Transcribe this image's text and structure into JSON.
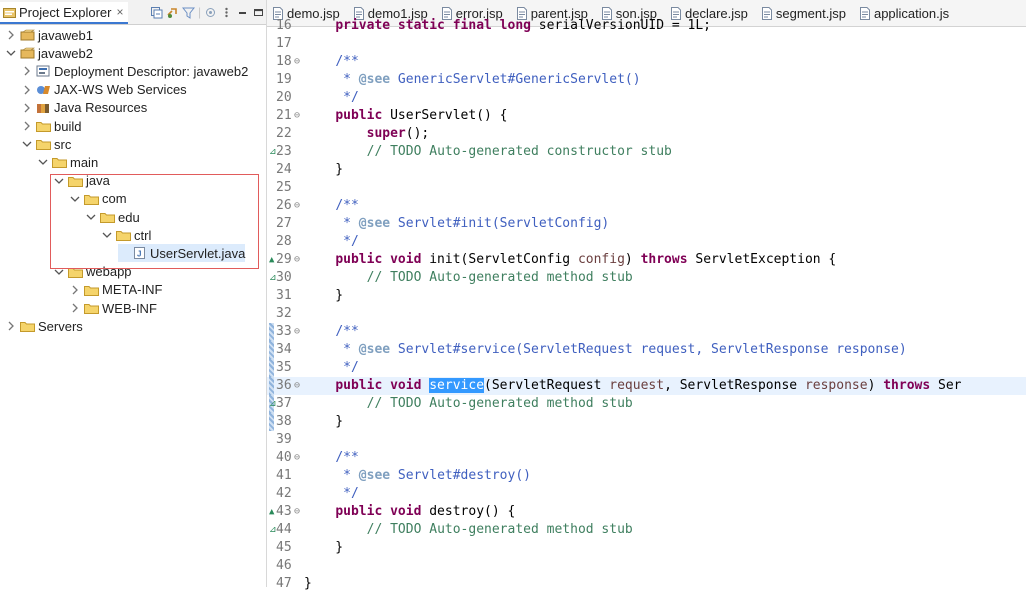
{
  "explorer": {
    "tab_label": "Project Explorer",
    "tab_close": "×",
    "tree": [
      {
        "label": "javaweb1",
        "icon": "project-icon",
        "expanded": false,
        "indent": 0
      },
      {
        "label": "javaweb2",
        "icon": "project-icon",
        "expanded": true,
        "indent": 0
      },
      {
        "label": "Deployment Descriptor: javaweb2",
        "icon": "descriptor-icon",
        "expanded": false,
        "indent": 1
      },
      {
        "label": "JAX-WS Web Services",
        "icon": "webservice-icon",
        "expanded": false,
        "indent": 1
      },
      {
        "label": "Java Resources",
        "icon": "library-icon",
        "expanded": false,
        "indent": 1
      },
      {
        "label": "build",
        "icon": "folder-icon",
        "expanded": false,
        "indent": 1
      },
      {
        "label": "src",
        "icon": "folder-icon",
        "expanded": true,
        "indent": 1
      },
      {
        "label": "main",
        "icon": "folder-icon",
        "expanded": true,
        "indent": 2
      },
      {
        "label": "java",
        "icon": "folder-icon",
        "expanded": true,
        "indent": 3
      },
      {
        "label": "com",
        "icon": "folder-icon",
        "expanded": true,
        "indent": 4
      },
      {
        "label": "edu",
        "icon": "folder-icon",
        "expanded": true,
        "indent": 5
      },
      {
        "label": "ctrl",
        "icon": "folder-icon",
        "expanded": true,
        "indent": 6
      },
      {
        "label": "UserServlet.java",
        "icon": "java-file-icon",
        "expanded": null,
        "indent": 7
      },
      {
        "label": "webapp",
        "icon": "folder-icon",
        "expanded": true,
        "indent": 3
      },
      {
        "label": "META-INF",
        "icon": "folder-icon",
        "expanded": false,
        "indent": 4
      },
      {
        "label": "WEB-INF",
        "icon": "folder-icon",
        "expanded": false,
        "indent": 4
      },
      {
        "label": "Servers",
        "icon": "folder-icon",
        "expanded": false,
        "indent": 0
      }
    ]
  },
  "editor": {
    "tabs": [
      "demo.jsp",
      "demo1.jsp",
      "error.jsp",
      "parent.jsp",
      "son.jsp",
      "declare.jsp",
      "segment.jsp",
      "application.js"
    ],
    "lines": [
      {
        "n": "16",
        "tokens": [
          {
            "t": "    "
          },
          {
            "t": "private static final long",
            "c": "kw"
          },
          {
            "t": " serialVersionUID = 1L;"
          }
        ]
      },
      {
        "n": "17",
        "tokens": []
      },
      {
        "n": "18",
        "fold": "⊖",
        "tokens": [
          {
            "t": "    "
          },
          {
            "t": "/**",
            "c": "jd"
          }
        ]
      },
      {
        "n": "19",
        "tokens": [
          {
            "t": "     * ",
            "c": "jd"
          },
          {
            "t": "@see",
            "c": "tag"
          },
          {
            "t": " GenericServlet#GenericServlet()",
            "c": "jd"
          }
        ]
      },
      {
        "n": "20",
        "tokens": [
          {
            "t": "     */",
            "c": "jd"
          }
        ]
      },
      {
        "n": "21",
        "fold": "⊖",
        "tokens": [
          {
            "t": "    "
          },
          {
            "t": "public",
            "c": "kw"
          },
          {
            "t": " UserServlet() {"
          }
        ]
      },
      {
        "n": "22",
        "tokens": [
          {
            "t": "        "
          },
          {
            "t": "super",
            "c": "kw"
          },
          {
            "t": "();"
          }
        ]
      },
      {
        "n": "23",
        "marker": "⊿",
        "tokens": [
          {
            "t": "        "
          },
          {
            "t": "// TODO Auto-generated constructor stub",
            "c": "cm"
          }
        ]
      },
      {
        "n": "24",
        "tokens": [
          {
            "t": "    }"
          }
        ]
      },
      {
        "n": "25",
        "tokens": []
      },
      {
        "n": "26",
        "fold": "⊖",
        "tokens": [
          {
            "t": "    "
          },
          {
            "t": "/**",
            "c": "jd"
          }
        ]
      },
      {
        "n": "27",
        "tokens": [
          {
            "t": "     * ",
            "c": "jd"
          },
          {
            "t": "@see",
            "c": "tag"
          },
          {
            "t": " Servlet#init(ServletConfig)",
            "c": "jd"
          }
        ]
      },
      {
        "n": "28",
        "tokens": [
          {
            "t": "     */",
            "c": "jd"
          }
        ]
      },
      {
        "n": "29",
        "fold": "⊖",
        "marker": "▲",
        "tokens": [
          {
            "t": "    "
          },
          {
            "t": "public void",
            "c": "kw"
          },
          {
            "t": " init(ServletConfig "
          },
          {
            "t": "config",
            "c": "var"
          },
          {
            "t": ") "
          },
          {
            "t": "throws",
            "c": "kw"
          },
          {
            "t": " ServletException {"
          }
        ]
      },
      {
        "n": "30",
        "marker": "⊿",
        "tokens": [
          {
            "t": "        "
          },
          {
            "t": "// TODO Auto-generated method stub",
            "c": "cm"
          }
        ]
      },
      {
        "n": "31",
        "tokens": [
          {
            "t": "    }"
          }
        ]
      },
      {
        "n": "32",
        "tokens": []
      },
      {
        "n": "33",
        "fold": "⊖",
        "strip": true,
        "tokens": [
          {
            "t": "    "
          },
          {
            "t": "/**",
            "c": "jd"
          }
        ]
      },
      {
        "n": "34",
        "strip": true,
        "tokens": [
          {
            "t": "     * ",
            "c": "jd"
          },
          {
            "t": "@see",
            "c": "tag"
          },
          {
            "t": " Servlet#service(ServletRequest request, ServletResponse response)",
            "c": "jd"
          }
        ]
      },
      {
        "n": "35",
        "strip": true,
        "tokens": [
          {
            "t": "     */",
            "c": "jd"
          }
        ]
      },
      {
        "n": "36",
        "fold": "⊖",
        "strip": true,
        "current": true,
        "tokens": [
          {
            "t": "    "
          },
          {
            "t": "public void",
            "c": "kw"
          },
          {
            "t": " "
          },
          {
            "t": "service",
            "c": "sel"
          },
          {
            "t": "(ServletRequest "
          },
          {
            "t": "request",
            "c": "var"
          },
          {
            "t": ", ServletResponse "
          },
          {
            "t": "response",
            "c": "var"
          },
          {
            "t": ") "
          },
          {
            "t": "throws",
            "c": "kw"
          },
          {
            "t": " Ser"
          }
        ]
      },
      {
        "n": "37",
        "strip": true,
        "marker": "⊿",
        "tokens": [
          {
            "t": "        "
          },
          {
            "t": "// TODO Auto-generated method stub",
            "c": "cm"
          }
        ]
      },
      {
        "n": "38",
        "strip": true,
        "tokens": [
          {
            "t": "    }"
          }
        ]
      },
      {
        "n": "39",
        "tokens": []
      },
      {
        "n": "40",
        "fold": "⊖",
        "tokens": [
          {
            "t": "    "
          },
          {
            "t": "/**",
            "c": "jd"
          }
        ]
      },
      {
        "n": "41",
        "tokens": [
          {
            "t": "     * ",
            "c": "jd"
          },
          {
            "t": "@see",
            "c": "tag"
          },
          {
            "t": " Servlet#destroy()",
            "c": "jd"
          }
        ]
      },
      {
        "n": "42",
        "tokens": [
          {
            "t": "     */",
            "c": "jd"
          }
        ]
      },
      {
        "n": "43",
        "fold": "⊖",
        "marker": "▲",
        "tokens": [
          {
            "t": "    "
          },
          {
            "t": "public void",
            "c": "kw"
          },
          {
            "t": " destroy() {"
          }
        ]
      },
      {
        "n": "44",
        "marker": "⊿",
        "tokens": [
          {
            "t": "        "
          },
          {
            "t": "// TODO Auto-generated method stub",
            "c": "cm"
          }
        ]
      },
      {
        "n": "45",
        "tokens": [
          {
            "t": "    }"
          }
        ]
      },
      {
        "n": "46",
        "tokens": []
      },
      {
        "n": "47",
        "tokens": [
          {
            "t": "}"
          }
        ]
      }
    ]
  }
}
